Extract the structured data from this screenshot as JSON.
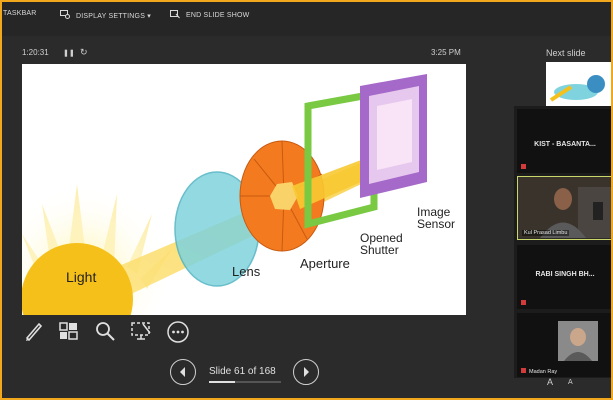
{
  "toolbar": {
    "taskbar_label": "TASKBAR",
    "display_settings_label": "DISPLAY SETTINGS ▾",
    "end_show_label": "END SLIDE SHOW"
  },
  "presenter": {
    "timer": "1:20:31",
    "clock": "3:25 PM",
    "slide_counter": "Slide 61 of 168",
    "progress_fraction": 0.363
  },
  "slide": {
    "labels": {
      "light": "Light",
      "lens": "Lens",
      "aperture": "Aperture",
      "shutter_line1": "Opened",
      "shutter_line2": "Shutter",
      "sensor_line1": "Image",
      "sensor_line2": "Sensor"
    }
  },
  "next_slide": {
    "label": "Next slide"
  },
  "participants": [
    {
      "name": "KIST - BASANTA...",
      "type": "name"
    },
    {
      "name": "Kul Prasad Limbu",
      "type": "video"
    },
    {
      "name": "RABI SINGH BH...",
      "type": "name"
    },
    {
      "name": "Madan Ray",
      "type": "photo"
    }
  ],
  "font_controls": {
    "increase": "A",
    "decrease": "A"
  },
  "colors": {
    "accent_border": "#f2a81d",
    "active_speaker": "#c8d86a"
  }
}
